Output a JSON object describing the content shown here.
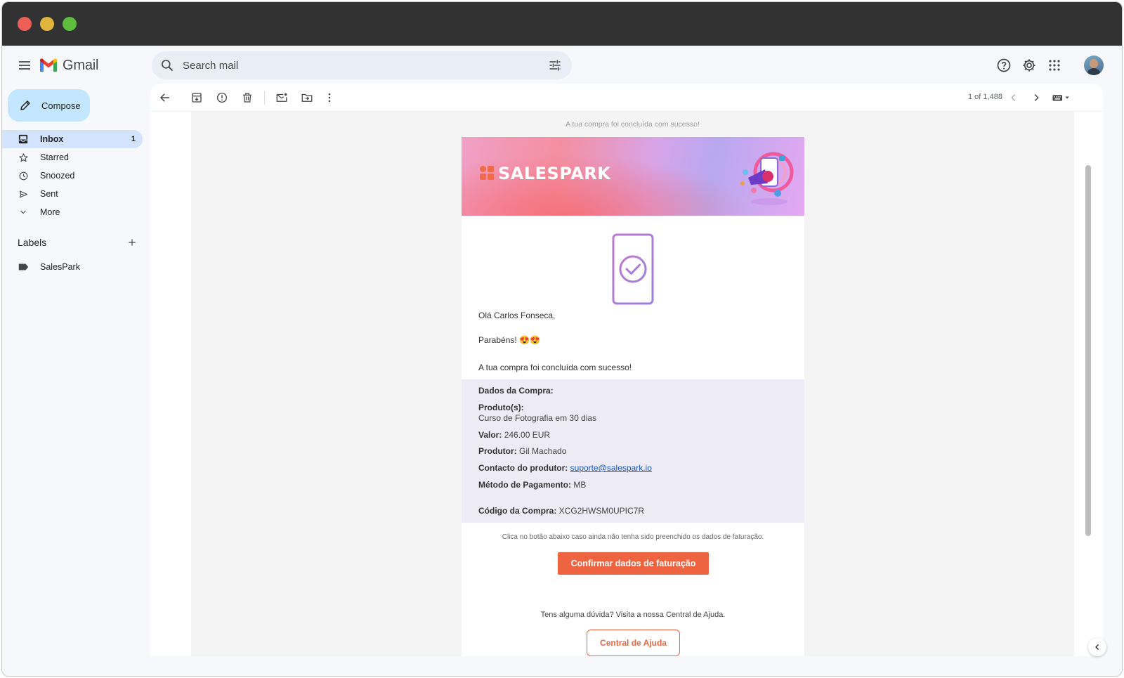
{
  "app": {
    "name": "Gmail"
  },
  "search": {
    "placeholder": "Search mail"
  },
  "compose": {
    "label": "Compose"
  },
  "nav": [
    {
      "label": "Inbox",
      "count": "1",
      "icon": "inbox-icon",
      "active": true
    },
    {
      "label": "Starred",
      "icon": "star-icon"
    },
    {
      "label": "Snoozed",
      "icon": "clock-icon"
    },
    {
      "label": "Sent",
      "icon": "send-icon"
    },
    {
      "label": "More",
      "icon": "chevron-down-icon"
    }
  ],
  "labels": {
    "header": "Labels",
    "items": [
      {
        "label": "SalesPark",
        "icon": "label-icon"
      }
    ]
  },
  "pager": {
    "text": "1 of 1,488"
  },
  "email": {
    "preheader": "A tua compra foi concluída com sucesso!",
    "brand": "SALESPARK",
    "greeting": "Olá Carlos Fonseca,",
    "congrats": "Parabéns! 😍😍",
    "success": "A tua compra foi concluída com sucesso!",
    "purchase": {
      "title": "Dados da Compra:",
      "products_label": "Produto(s):",
      "product": "Curso de Fotografia em 30 dias",
      "value_label": "Valor:",
      "value": "246.00 EUR",
      "producer_label": "Produtor:",
      "producer": "Gil Machado",
      "contact_label": "Contacto do produtor:",
      "contact": "suporte@salespark.io",
      "payment_label": "Método de Pagamento:",
      "payment": "MB",
      "code_label": "Código da Compra:",
      "code": "XCG2HWSM0UPIC7R"
    },
    "hint": "Clica no botão abaixo caso ainda não tenha sido preenchido os dados de faturação.",
    "confirm_button": "Confirmar dados de faturação",
    "help": "Tens alguma dúvida? Visita a nossa Central de Ajuda.",
    "help_button": "Central de Ajuda"
  },
  "colors": {
    "accent": "#ef6440",
    "compose": "#c2e7ff",
    "active_nav": "#d3e3fd",
    "purchase_bg": "#ecebf6"
  }
}
